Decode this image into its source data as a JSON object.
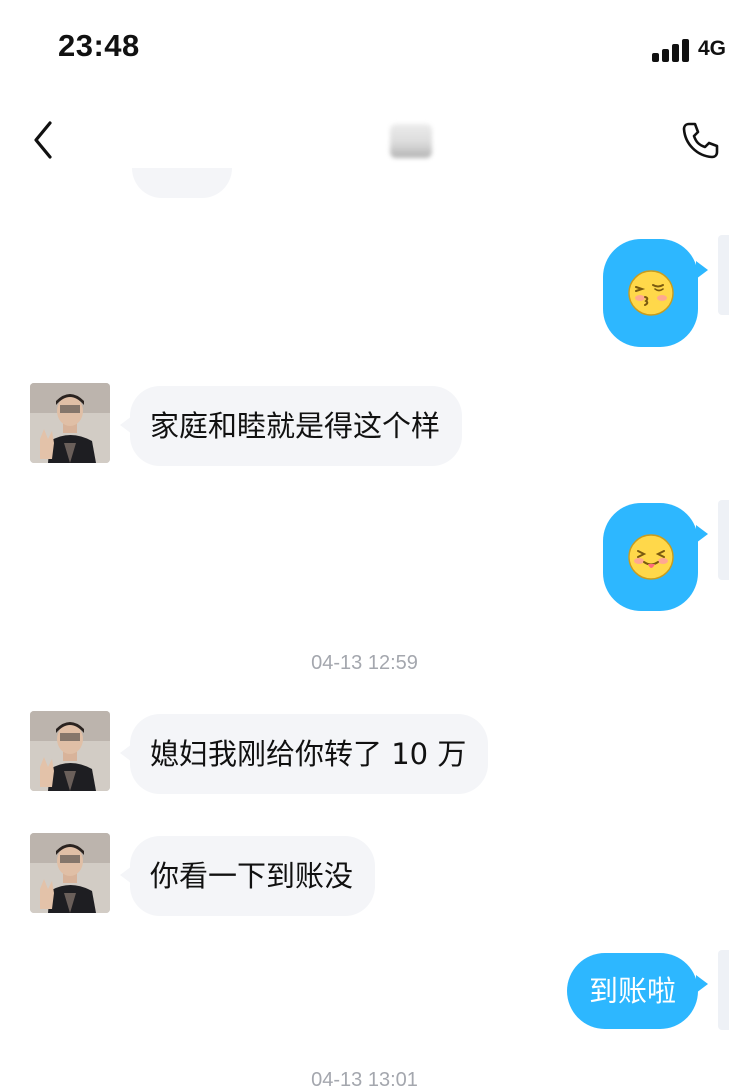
{
  "status_bar": {
    "time": "23:48",
    "network": "4G"
  },
  "nav": {
    "back_icon": "chevron-left-icon",
    "call_icon": "phone-icon"
  },
  "messages": [
    {
      "type": "emoji",
      "direction": "outgoing",
      "emoji": "kiss-face-emoji"
    },
    {
      "type": "text",
      "direction": "incoming",
      "text": "家庭和睦就是得这个样"
    },
    {
      "type": "emoji",
      "direction": "outgoing",
      "emoji": "tongue-out-face-emoji"
    },
    {
      "type": "timestamp",
      "text": "04-13 12:59"
    },
    {
      "type": "text",
      "direction": "incoming",
      "text": "媳妇我刚给你转了 10 万"
    },
    {
      "type": "text",
      "direction": "incoming",
      "text": "你看一下到账没"
    },
    {
      "type": "text",
      "direction": "outgoing",
      "text": "到账啦"
    },
    {
      "type": "timestamp",
      "text": "04-13 13:01"
    }
  ],
  "colors": {
    "outgoing_bubble": "#2db7ff",
    "incoming_bubble": "#f4f5f8",
    "timestamp_text": "#a4a7ae"
  }
}
